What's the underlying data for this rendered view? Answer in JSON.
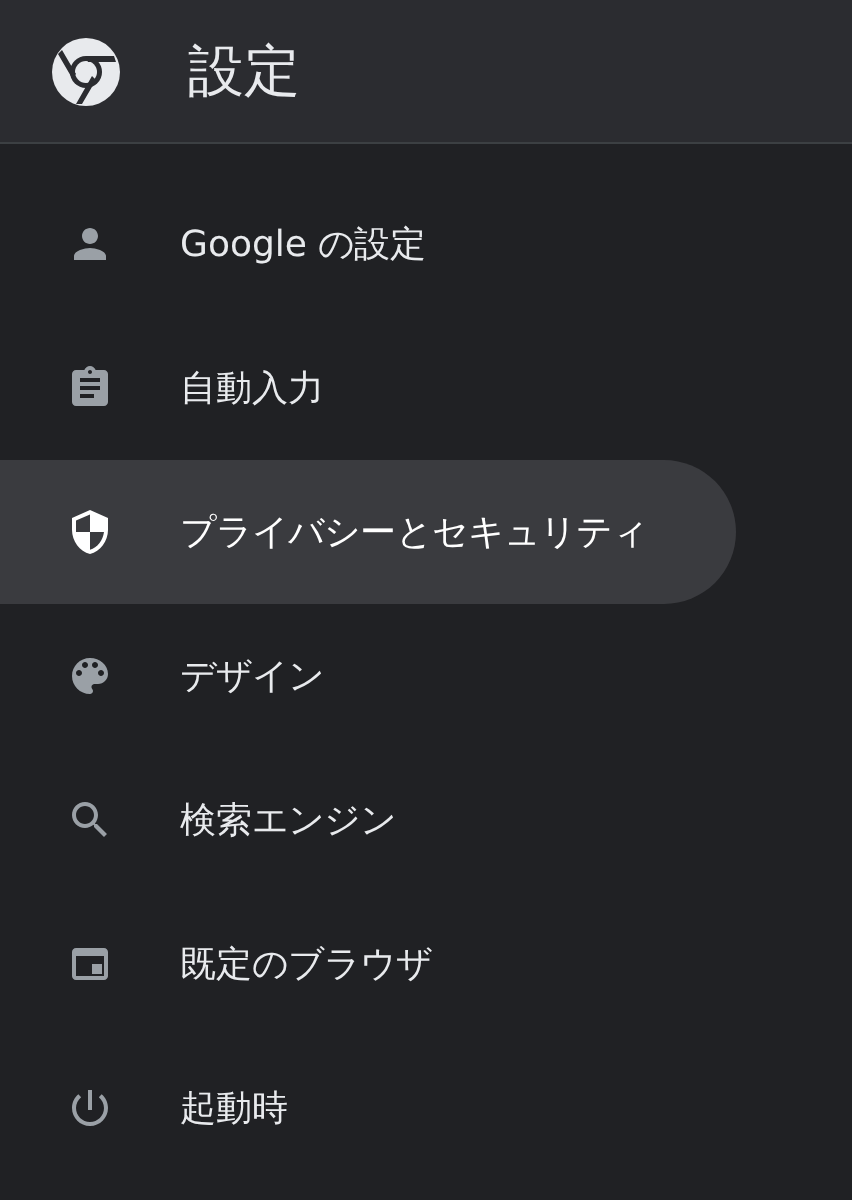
{
  "header": {
    "title": "設定"
  },
  "menu": [
    {
      "label": "Google の設定",
      "selected": false
    },
    {
      "label": "自動入力",
      "selected": false
    },
    {
      "label": "プライバシーとセキュリティ",
      "selected": true
    },
    {
      "label": "デザイン",
      "selected": false
    },
    {
      "label": "検索エンジン",
      "selected": false
    },
    {
      "label": "既定のブラウザ",
      "selected": false
    },
    {
      "label": "起動時",
      "selected": false
    }
  ]
}
